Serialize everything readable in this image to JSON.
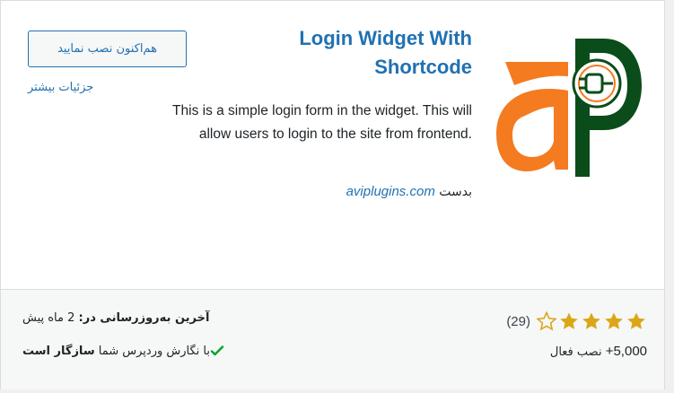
{
  "plugin": {
    "title": "Login Widget With Shortcode",
    "install_label": "هم‌اکنون نصب نمایید",
    "more_details_label": "جزئیات بیشتر",
    "description": "This is a simple login form in the widget. This will allow users to login to the site from frontend.",
    "author_prefix": "بدست",
    "author_name": "aviplugins.com",
    "icon": "aviplugins-logo"
  },
  "footer": {
    "rating": {
      "stars": 4.5,
      "max": 5,
      "count_text": "(29)"
    },
    "active_installs_number": "+5,000",
    "active_installs_label": "نصب فعال",
    "last_updated_label": "آخرین به‌روزرسانی در:",
    "last_updated_value": "2 ماه پیش",
    "compat_prefix": "با نگارش وردپرس شما",
    "compat_status": "سازگار است",
    "compat_icon": "checkmark-icon"
  },
  "colors": {
    "accent": "#2271b1",
    "star": "#dba617",
    "check": "#00a32a",
    "logo_orange": "#f47b20",
    "logo_green": "#0b4d1a"
  }
}
